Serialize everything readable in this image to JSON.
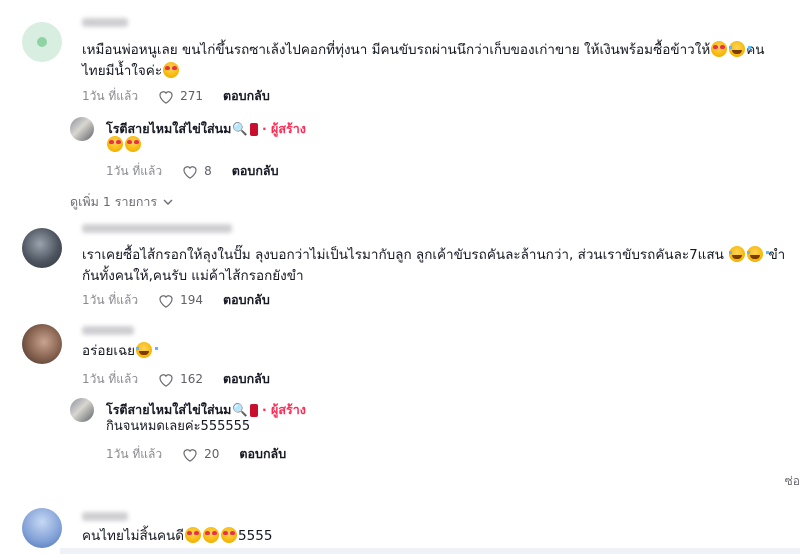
{
  "comments": [
    {
      "text_line1": "เหมือนพ่อหนูเลย ขนไก่ขึ้นรถซาเล้งไปคอกที่ทุ่งนา มีคนขับรถผ่านนึกว่าเก็บของเก่าขาย ให้เงินพร้อมซื้อข้าวให้",
      "text_line1_tail": "คน",
      "text_line2": "ไทยมีน้ำใจค่ะ",
      "time": "1วัน ที่แล้ว",
      "likes": "271",
      "reply": "ตอบกลับ",
      "avatar_color": "#cdebd6",
      "reply_item": {
        "name": "โรตีสายไหมใส่ไข่ใส่นม",
        "tag": "· ผู้สร้าง",
        "time": "1วัน ที่แล้ว",
        "likes": "8",
        "reply": "ตอบกลับ"
      }
    },
    {
      "text_line1": "เราเคยซื้อไส้กรอกให้ลุงในปั๊ม ลุงบอกว่าไม่เป็นไรมากับลูก ลูกเค้าขับรถคันละล้านกว่า, ส่วนเราขับรถคันละ7แสน",
      "text_line1_tail": "ขำ",
      "text_line2": "กันทั้งคนให้,คนรับ แม่ค้าไส้กรอกยังขำ",
      "time": "1วัน ที่แล้ว",
      "likes": "194",
      "reply": "ตอบกลับ"
    },
    {
      "text_line1": "อร่อยเฉย",
      "time": "1วัน ที่แล้ว",
      "likes": "162",
      "reply": "ตอบกลับ",
      "reply_item": {
        "name": "โรตีสายไหมใส่ไข่ใส่นม",
        "tag": "· ผู้สร้าง",
        "text": "กินจนหมดเลยค่ะ555555",
        "time": "1วัน ที่แล้ว",
        "likes": "20",
        "reply": "ตอบกลับ"
      }
    },
    {
      "text_tail": "5555",
      "text_head": "คนไทยไม่สิ้นคนดี"
    }
  ],
  "view_more": "ดูเพิ่ม 1 รายการ",
  "side_text": "ซ่อ"
}
